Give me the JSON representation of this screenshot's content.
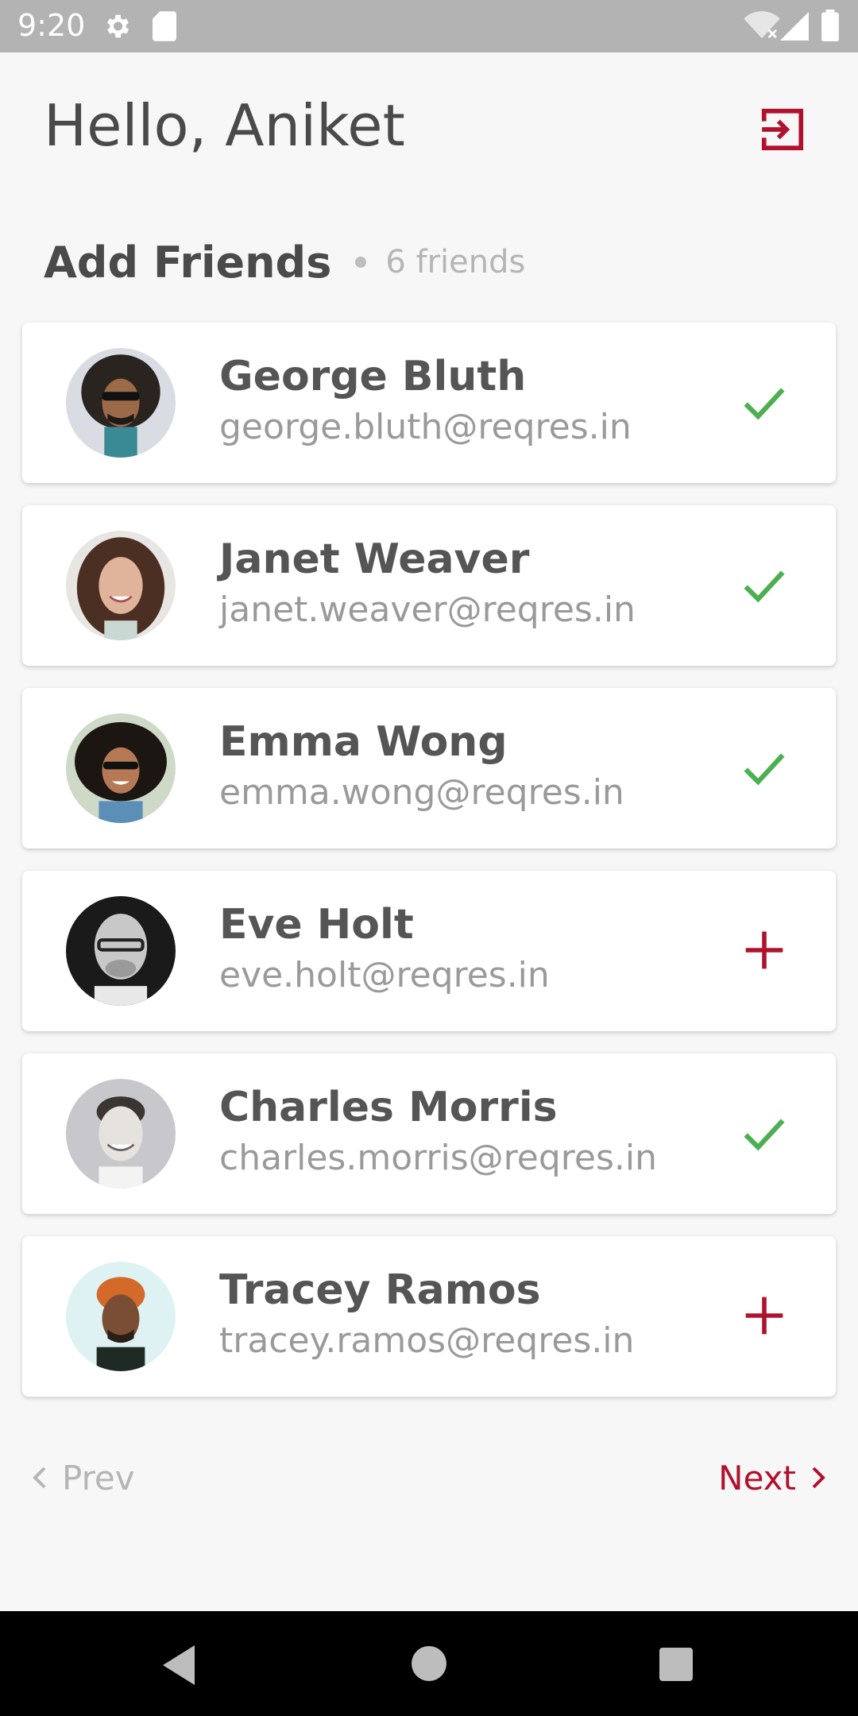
{
  "status_bar": {
    "time": "9:20",
    "icons": [
      "gear-icon",
      "sd-card-icon",
      "wifi-off-icon",
      "signal-icon",
      "battery-icon"
    ]
  },
  "header": {
    "greeting": "Hello, Aniket",
    "logout_icon": "logout-icon"
  },
  "section": {
    "title": "Add Friends",
    "count": "6 friends"
  },
  "friends": [
    {
      "name": "George Bluth",
      "email": "george.bluth@reqres.in",
      "added": true
    },
    {
      "name": "Janet Weaver",
      "email": "janet.weaver@reqres.in",
      "added": true
    },
    {
      "name": "Emma Wong",
      "email": "emma.wong@reqres.in",
      "added": true
    },
    {
      "name": "Eve Holt",
      "email": "eve.holt@reqres.in",
      "added": false
    },
    {
      "name": "Charles Morris",
      "email": "charles.morris@reqres.in",
      "added": true
    },
    {
      "name": "Tracey Ramos",
      "email": "tracey.ramos@reqres.in",
      "added": false
    }
  ],
  "pager": {
    "prev_label": "Prev",
    "next_label": "Next"
  },
  "colors": {
    "accent": "#b0122e",
    "added_check": "#4caf50",
    "text_primary": "#4a4a4a",
    "text_secondary": "#9a9a9a"
  }
}
